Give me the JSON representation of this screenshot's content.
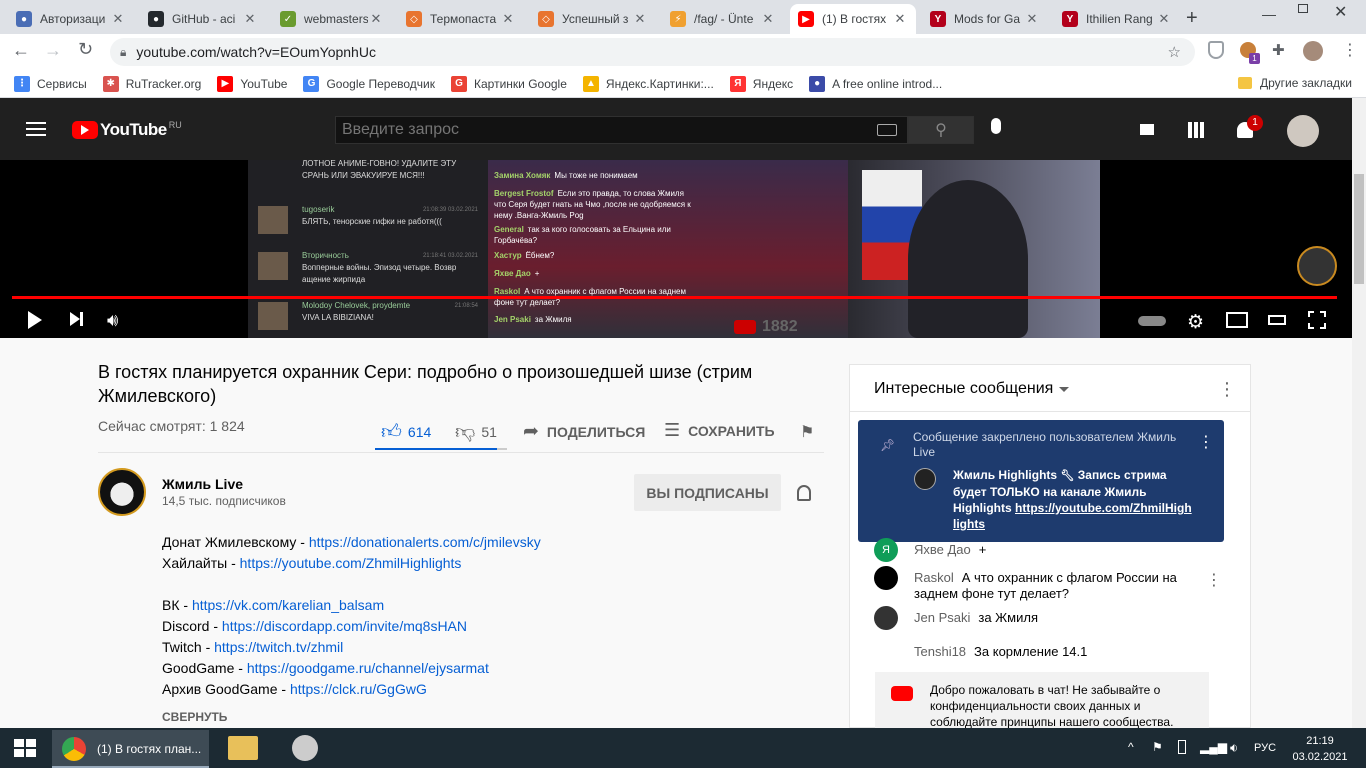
{
  "browser": {
    "tabs": [
      {
        "label": "Авторизаци",
        "color": "#4a6db5",
        "glyph": "●"
      },
      {
        "label": "GitHub - aci",
        "color": "#24292e",
        "glyph": "●"
      },
      {
        "label": "webmasters",
        "color": "#6a9b2f",
        "glyph": "✓"
      },
      {
        "label": "Термопаста",
        "color": "#e8742f",
        "glyph": "◇"
      },
      {
        "label": "Успешный з",
        "color": "#e8742f",
        "glyph": "◇"
      },
      {
        "label": "/fag/ - Ünte",
        "color": "#f0a030",
        "glyph": "⚡"
      },
      {
        "label": "(1) В гостях",
        "color": "#ff0000",
        "glyph": "▶"
      },
      {
        "label": "Mods for Ga",
        "color": "#b3001b",
        "glyph": "Y"
      },
      {
        "label": "Ithilien Rang",
        "color": "#b3001b",
        "glyph": "Y"
      }
    ],
    "new_tab": "+",
    "url": "youtube.com/watch?v=EOumYopnhUc",
    "bookmarks": [
      {
        "label": "Сервисы",
        "color": "#4285f4",
        "glyph": "⋮"
      },
      {
        "label": "RuTracker.org",
        "color": "#d9534f",
        "glyph": "✱"
      },
      {
        "label": "YouTube",
        "color": "#ff0000",
        "glyph": "▶"
      },
      {
        "label": "Google Переводчик",
        "color": "#4285f4",
        "glyph": "G"
      },
      {
        "label": "Картинки Google",
        "color": "#ea4335",
        "glyph": "G"
      },
      {
        "label": "Яндекс.Картинки:...",
        "color": "#f4b400",
        "glyph": "▲"
      },
      {
        "label": "Яндекс",
        "color": "#ff3333",
        "glyph": "Я"
      },
      {
        "label": "A free online introd...",
        "color": "#3b4ba8",
        "glyph": "●"
      }
    ],
    "other_bookmarks": "Другие закладки",
    "extension_badge": "1"
  },
  "youtube": {
    "logo_text": "YouTube",
    "logo_region": "RU",
    "search_placeholder": "Введите запрос",
    "notification_count": "1",
    "player": {
      "viewer_overlay": "1882",
      "progress_fraction": 1.0,
      "overlay_chat": [
        {
          "name": "",
          "text": "ЛОТНОЕ АНИМЕ-ГОВНО! УДАЛИТЕ ЭТУ СРАНЬ ИЛИ ЭВАКУИРУЕ МСЯ!!!"
        },
        {
          "name": "tugoserik",
          "text": "БЛЯТЬ, тенорские гифки не работя(((",
          "time": "21:08:39 03.02.2021"
        },
        {
          "name": "Вторичность",
          "text": "Вопперные войны. Эпизод четыре. Возвр ащение жирпида",
          "time": "21:18:41 03.02.2021"
        },
        {
          "name": "Molodoy Chelovek, proydemte",
          "text": "VIVA LA BIBIZIANA!",
          "time": "21:08:54"
        }
      ],
      "overlay_chat2": [
        {
          "name": "Замина Хомяк",
          "text": "Мы тоже не понимаем"
        },
        {
          "name": "Bergest Frostof",
          "text": "Если это правда, то слова Жмиля что Серя будет гнать на Чмо ,после не одобряемся к нему .Ванга-Жмиль Pog"
        },
        {
          "name": "General",
          "text": "так за кого голосовать за Ельцина или Горбачёва?"
        },
        {
          "name": "Хастур",
          "text": "Ёбнем?"
        },
        {
          "name": "Яхве Дао",
          "text": "+"
        },
        {
          "name": "Raskol",
          "text": "А что охранник с флагом России на заднем фоне тут делает?"
        },
        {
          "name": "Jen Psaki",
          "text": "за Жмиля"
        }
      ]
    },
    "video": {
      "title": "В гостях планируется охранник Сери: подробно о произошедшей шизе (стрим Жмилевского)",
      "viewers": "Сейчас смотрят: 1 824",
      "likes": "614",
      "dislikes": "51",
      "share": "ПОДЕЛИТЬСЯ",
      "save": "СОХРАНИТЬ",
      "like_ratio": 0.923
    },
    "channel": {
      "name": "Жмиль Live",
      "subscribers": "14,5 тыс. подписчиков",
      "subscribe_label": "ВЫ ПОДПИСАНЫ"
    },
    "description": [
      {
        "text": "Донат Жмилевскому - ",
        "link": "https://donationalerts.com/c/jmilevsky"
      },
      {
        "text": "Хайлайты - ",
        "link": "https://youtube.com/ZhmilHighlights"
      },
      {
        "text": "",
        "link": ""
      },
      {
        "text": "ВК - ",
        "link": "https://vk.com/karelian_balsam"
      },
      {
        "text": "Discord - ",
        "link": "https://discordapp.com/invite/mq8sHAN"
      },
      {
        "text": "Twitch - ",
        "link": "https://twitch.tv/zhmil"
      },
      {
        "text": "GoodGame - ",
        "link": "https://goodgame.ru/channel/ejysarmat"
      },
      {
        "text": "Архив GoodGame - ",
        "link": "https://clck.ru/GgGwG"
      }
    ],
    "collapse": "СВЕРНУТЬ",
    "chat": {
      "header": "Интересные сообщения",
      "pinned_header": "Сообщение закреплено пользователем Жмиль Live",
      "pinned_author": "Жмиль Highlights",
      "pinned_text": "Запись стрима будет ТОЛЬКО на канале Жмиль Highlights ",
      "pinned_link": "https://youtube.com/ZhmilHighlights",
      "messages": [
        {
          "author": "Яхве Дао",
          "text": "+",
          "avatar_color": "#0f9d58",
          "letter": "Я"
        },
        {
          "author": "Raskol",
          "text": "А что охранник с флагом России на заднем фоне тут делает?",
          "avatar_color": "#000000",
          "letter": ""
        },
        {
          "author": "Jen Psaki",
          "text": "за Жмиля",
          "avatar_color": "#333333",
          "letter": ""
        },
        {
          "author": "Tenshi18",
          "text": "За кормление 14.1",
          "avatar_color": "#ffffff",
          "letter": ""
        }
      ],
      "welcome": "Добро пожаловать в чат! Не забывайте о конфиденциальности своих данных и соблюдайте принципы нашего сообщества."
    }
  },
  "taskbar": {
    "task_label": "(1) В гостях план...",
    "lang": "РУС",
    "time": "21:19",
    "date": "03.02.2021"
  }
}
